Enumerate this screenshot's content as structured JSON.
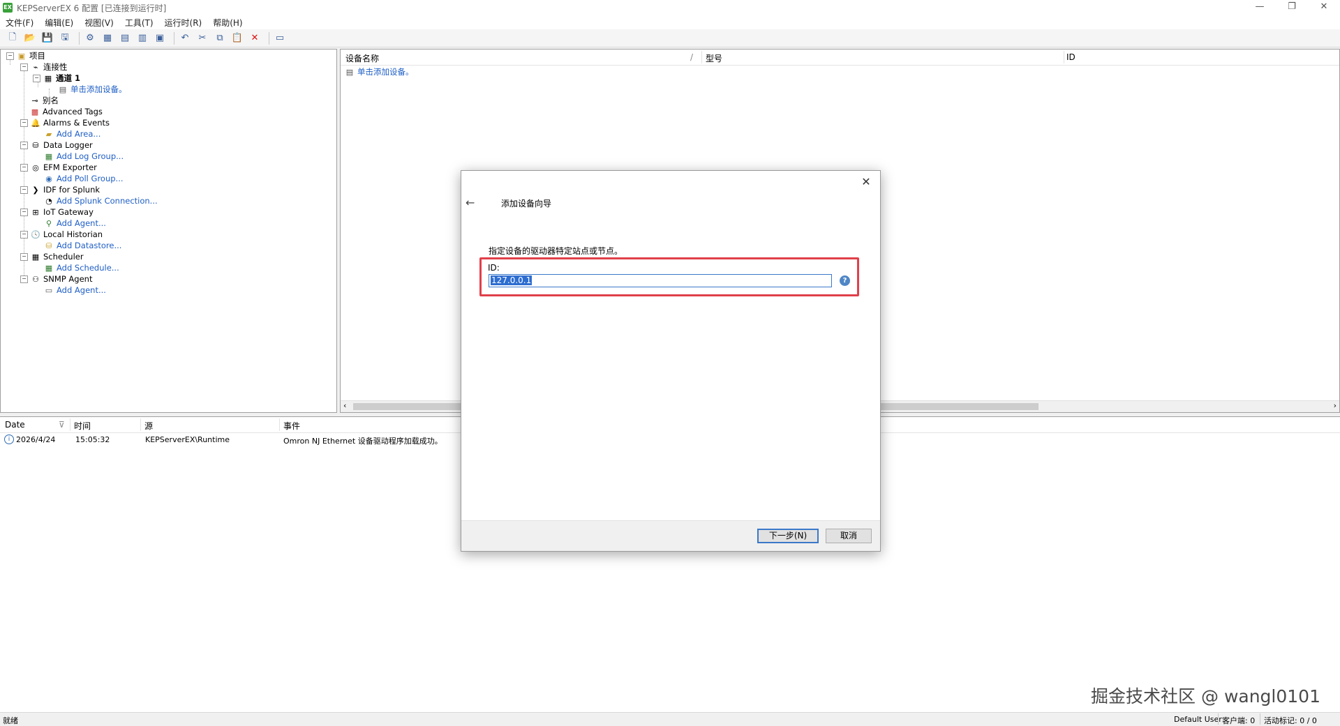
{
  "window": {
    "title": "KEPServerEX 6 配置 [已连接到运行时]",
    "app_icon_text": "EX",
    "controls": [
      "—",
      "❐",
      "✕"
    ]
  },
  "menu": [
    "文件(F)",
    "编辑(E)",
    "视图(V)",
    "工具(T)",
    "运行时(R)",
    "帮助(H)"
  ],
  "toolbar": {
    "icons": [
      "new-project-icon",
      "open-icon",
      "save-icon",
      "save-as-icon",
      "separator",
      "new-channel-icon",
      "new-device-icon",
      "new-tag-icon",
      "new-tag-group-icon",
      "properties-icon",
      "separator",
      "undo-icon",
      "cut-icon",
      "copy-icon",
      "paste-icon",
      "delete-icon",
      "separator",
      "quick-client-icon"
    ]
  },
  "tree": {
    "project": "项目",
    "connectivity": "连接性",
    "channel": "通道 1",
    "add_device": "单击添加设备。",
    "aliases": "别名",
    "advanced_tags": "Advanced Tags",
    "alarms_events": "Alarms & Events",
    "add_area": "Add Area...",
    "data_logger": "Data Logger",
    "add_log_group": "Add Log Group...",
    "efm_exporter": "EFM Exporter",
    "add_poll_group": "Add Poll Group...",
    "idf_splunk": "IDF for Splunk",
    "add_splunk": "Add Splunk Connection...",
    "iot_gateway": "IoT Gateway",
    "add_agent_iot": "Add Agent...",
    "local_historian": "Local Historian",
    "add_datastore": "Add Datastore...",
    "scheduler": "Scheduler",
    "add_schedule": "Add Schedule...",
    "snmp_agent": "SNMP Agent",
    "add_agent_snmp": "Add Agent..."
  },
  "device_list": {
    "col_name": "设备名称",
    "col_model": "型号",
    "col_id": "ID",
    "add_device": "单击添加设备。"
  },
  "log": {
    "columns": [
      "Date",
      "时间",
      "源",
      "事件"
    ],
    "rows": [
      {
        "date": "2026/4/24",
        "time": "15:05:32",
        "source": "KEPServerEX\\Runtime",
        "event": "Omron NJ Ethernet 设备驱动程序加载成功。"
      }
    ]
  },
  "status": {
    "left": "就绪",
    "user": "Default User",
    "clients": "客户端: 0",
    "active_tags": "活动标记: 0 / 0"
  },
  "watermark": "掘金技术社区 @ wangl0101",
  "dialog": {
    "title": "添加设备向导",
    "description": "指定设备的驱动器特定站点或节点。",
    "id_label": "ID:",
    "id_value": "127.0.0.1",
    "help": "?",
    "next_label": "下一步(N)",
    "cancel_label": "取消"
  }
}
